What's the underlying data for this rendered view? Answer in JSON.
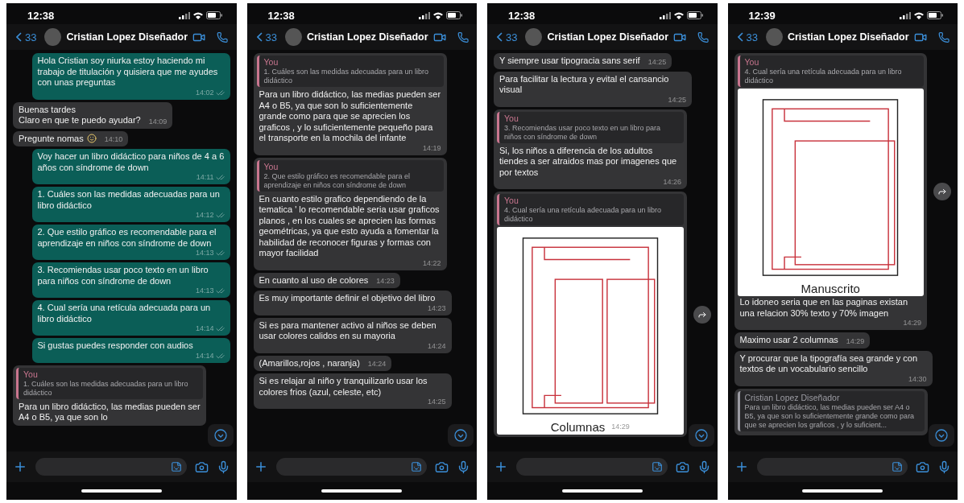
{
  "phones": [
    {
      "status_time": "12:38",
      "back_count": "33",
      "contact": "Cristian Lopez Diseñador",
      "messages": [
        {
          "kind": "out",
          "text": "Hola Cristian soy niurka estoy haciendo mi trabajo de titulación y quisiera que me ayudes con unas preguntas",
          "time": "14:02",
          "read": false
        },
        {
          "kind": "in",
          "text": "Buenas tardes\nClaro en que te puedo ayudar?",
          "time": "14:09"
        },
        {
          "kind": "in",
          "text": "Pregunte nomas",
          "time": "14:10",
          "emoji": true
        },
        {
          "kind": "out",
          "text": "Voy hacer un libro didáctico para niños de 4 a 6 años con síndrome de down",
          "time": "14:11",
          "read": false
        },
        {
          "kind": "out",
          "text": "1. Cuáles son las medidas adecuadas para un libro didáctico",
          "time": "14:12",
          "read": false
        },
        {
          "kind": "out",
          "text": "2. Que estilo gráfico es recomendable para el aprendizaje en niños con síndrome de down",
          "time": "14:13",
          "read": false
        },
        {
          "kind": "out",
          "text": "3. Recomiendas usar poco texto en un libro para niños con síndrome de down",
          "time": "14:13",
          "read": false
        },
        {
          "kind": "out",
          "text": "4. Cual sería una retícula adecuada para un libro didáctico",
          "time": "14:14",
          "read": false
        },
        {
          "kind": "out",
          "text": "Si gustas puedes responder con audios",
          "time": "14:14",
          "read": false
        },
        {
          "kind": "in",
          "quote": {
            "author": "You",
            "text": "1. Cuáles son las medidas adecuadas para un libro didáctico",
            "color": "#c9768f"
          },
          "text": "Para un libro didáctico, las medias pueden ser  A4 o B5, ya que son lo"
        }
      ]
    },
    {
      "status_time": "12:38",
      "back_count": "33",
      "contact": "Cristian Lopez Diseñador",
      "messages": [
        {
          "kind": "in",
          "quote": {
            "author": "You",
            "text": "1. Cuáles son las medidas adecuadas para un libro didáctico",
            "color": "#c9768f"
          },
          "text": "Para un libro didáctico, las medias pueden ser  A4 o B5, ya que son lo suficientemente grande como para que se aprecien los graficos , y lo suficientemente pequeño para el transporte en la mochila del infante",
          "time": "14:19"
        },
        {
          "kind": "in",
          "quote": {
            "author": "You",
            "text": "2. Que estilo gráfico es recomendable para el aprendizaje en niños con síndrome de down",
            "color": "#c9768f"
          },
          "text": "En cuanto estilo grafico dependiendo de la tematica ' lo recomendable seria usar graficos planos , en los cuales se aprecien las formas geométricas, ya que esto ayuda a fomentar la habilidad de reconocer figuras y formas con mayor facilidad",
          "time": "14:22"
        },
        {
          "kind": "in",
          "text": "En cuanto al uso de colores",
          "time": "14:23"
        },
        {
          "kind": "in",
          "text": "Es muy importante definir el objetivo del libro",
          "time": "14:23"
        },
        {
          "kind": "in",
          "text": "Si es para mantener activo al niños se deben usar colores calidos en su mayoria",
          "time": "14:24"
        },
        {
          "kind": "in",
          "text": "(Amarillos,rojos , naranja)",
          "time": "14:24"
        },
        {
          "kind": "in",
          "text": "Si es relajar al niño y tranquilizarlo usar los colores frios (azul, celeste, etc)",
          "time": "14:25"
        }
      ]
    },
    {
      "status_time": "12:38",
      "back_count": "33",
      "contact": "Cristian Lopez Diseñador",
      "messages": [
        {
          "kind": "in",
          "text": "Y siempre usar tipogracia sans serif",
          "time": "14:25"
        },
        {
          "kind": "in",
          "text": "Para facilitar la lectura y evital el cansancio visual",
          "time": "14:25"
        },
        {
          "kind": "in",
          "quote": {
            "author": "You",
            "text": "3. Recomiendas usar poco texto en un libro para niños con síndrome de down",
            "color": "#c9768f"
          },
          "text": "Si, los niños a diferencia de los adultos tiendes a ser atraidos mas por imagenes que por textos",
          "time": "14:26"
        },
        {
          "kind": "image",
          "quote": {
            "author": "You",
            "text": "4. Cual sería una retícula adecuada para un libro didáctico",
            "color": "#c9768f"
          },
          "image": {
            "kind": "columns",
            "label": "Columnas"
          },
          "time": "14:29",
          "forward_button": true
        }
      ]
    },
    {
      "status_time": "12:39",
      "back_count": "33",
      "contact": "Cristian Lopez Diseñador",
      "messages": [
        {
          "kind": "image",
          "quote": {
            "author": "You",
            "text": "4. Cual sería una retícula adecuada para un libro didáctico",
            "color": "#c9768f"
          },
          "image": {
            "kind": "single",
            "label": "Manuscrito"
          },
          "text": "Lo idoneo seria que en las paginas existan una relacion 30% texto y 70% imagen",
          "time": "14:29",
          "forward_button": true
        },
        {
          "kind": "in",
          "text": "Maximo usar 2 columnas",
          "time": "14:29"
        },
        {
          "kind": "in",
          "text": "Y procurar que la tipografía sea grande y con textos de un vocabulario sencillo",
          "time": "14:30"
        },
        {
          "kind": "in",
          "quote": {
            "author": "Cristian Lopez Diseñador",
            "text": "Para un libro didáctico, las medias pueden ser  A4 o B5, ya que son lo suficientemente grande como para que se aprecien los graficos , y lo suficient...",
            "color": "#9c9ca3"
          }
        }
      ]
    }
  ]
}
